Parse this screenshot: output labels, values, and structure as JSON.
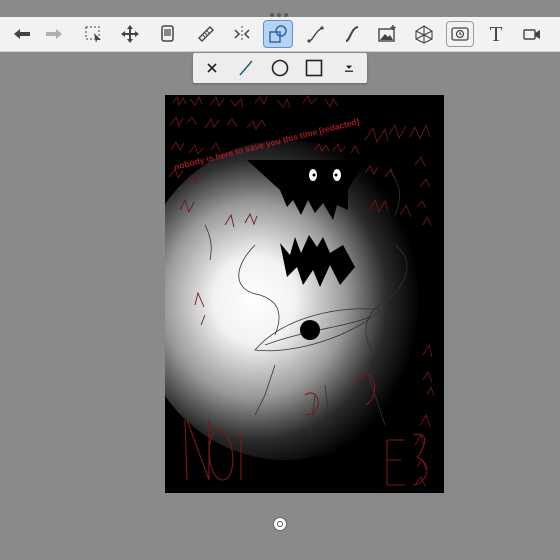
{
  "toolbar": {
    "tools": [
      {
        "id": "undo",
        "icon": "undo-arrow-icon"
      },
      {
        "id": "redo",
        "icon": "redo-arrow-icon"
      },
      {
        "id": "select",
        "icon": "selection-icon"
      },
      {
        "id": "move",
        "icon": "move-icon"
      },
      {
        "id": "layers",
        "icon": "layers-icon"
      },
      {
        "id": "ruler",
        "icon": "ruler-icon"
      },
      {
        "id": "symmetry",
        "icon": "symmetry-icon"
      },
      {
        "id": "shapes",
        "icon": "shapes-icon",
        "active": true
      },
      {
        "id": "curve",
        "icon": "curve-icon"
      },
      {
        "id": "stroke",
        "icon": "stroke-icon"
      },
      {
        "id": "image",
        "icon": "image-icon"
      },
      {
        "id": "perspective",
        "icon": "perspective-icon"
      },
      {
        "id": "time-lapse",
        "icon": "timelapse-icon",
        "framed": true
      },
      {
        "id": "text",
        "icon": "text-icon",
        "label": "T"
      },
      {
        "id": "video",
        "icon": "video-icon"
      }
    ]
  },
  "shape_bar": {
    "items": [
      {
        "id": "close",
        "icon": "close-icon"
      },
      {
        "id": "line",
        "icon": "line-icon"
      },
      {
        "id": "ellipse",
        "icon": "ellipse-icon"
      },
      {
        "id": "rectangle",
        "icon": "rectangle-icon"
      },
      {
        "id": "more",
        "icon": "dropdown-icon"
      }
    ]
  },
  "artwork": {
    "banner_text": "nobody is here to save you this time [redacted]",
    "colors": {
      "scribble": "#7a1818",
      "banner": "#a01c1c",
      "glow": "#ffffff",
      "bg": "#000000"
    }
  },
  "colors": {
    "accent": "#b7d3ef",
    "toolbar_bg": "#f2f2f2",
    "page_bg": "#8a8a8a"
  }
}
